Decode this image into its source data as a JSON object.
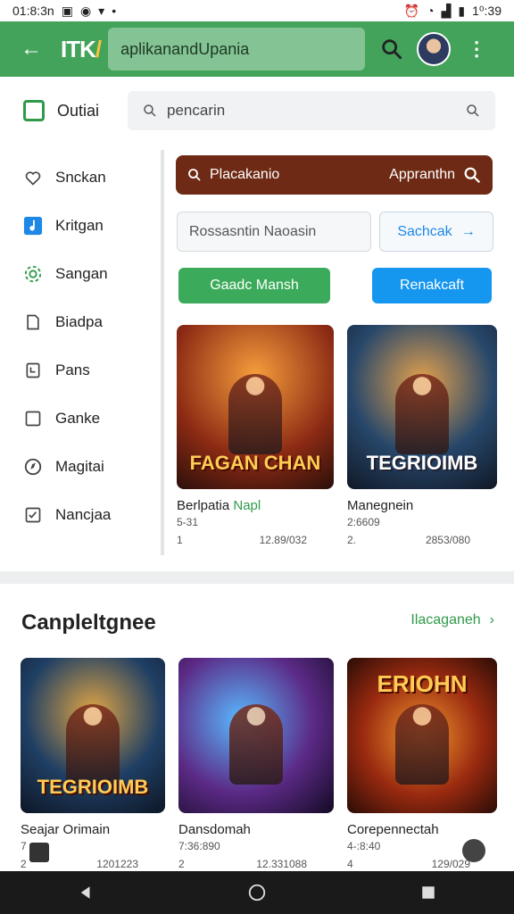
{
  "status": {
    "time_left": "01:8:3n",
    "time_right": "1⁰:39"
  },
  "appbar": {
    "logo": "ITK",
    "logo_accent": "/",
    "url": "aplikanandUpania"
  },
  "header": {
    "label": "Outiai",
    "search_placeholder": "pencarin"
  },
  "sidebar": {
    "items": [
      {
        "label": "Snckan",
        "icon": "heart-shield-icon"
      },
      {
        "label": "Kritgan",
        "icon": "music-note-icon"
      },
      {
        "label": "Sangan",
        "icon": "gear-icon"
      },
      {
        "label": "Biadpa",
        "icon": "document-icon"
      },
      {
        "label": "Pans",
        "icon": "bookmark-icon"
      },
      {
        "label": "Ganke",
        "icon": "square-icon"
      },
      {
        "label": "Magitai",
        "icon": "compass-icon"
      },
      {
        "label": "Nancjaa",
        "icon": "check-box-icon"
      }
    ]
  },
  "main": {
    "big_search": {
      "left": "Placakanio",
      "right": "Appranthn"
    },
    "field_placeholder": "Rossasntin Naoasin",
    "search_button": "Sachcak",
    "green_button": "Gaadc Mansh",
    "blue_button": "Renakcaft",
    "cards": [
      {
        "title": "Berlpatia",
        "title_accent": "Napl",
        "sub": "5-31",
        "meta_left": "1",
        "meta_right": "12.89/032",
        "art_text": "FAGAN CHAN"
      },
      {
        "title": "Manegnein",
        "title_accent": "",
        "sub": "2:6609",
        "meta_left": "2.",
        "meta_right": "2853/080",
        "art_text": "TEGRIOIMB"
      }
    ]
  },
  "section": {
    "title": "Canpleltgnee",
    "more": "Ilacaganeh",
    "cards": [
      {
        "title": "Seajar Orimain",
        "sub": "7",
        "meta_left": "2",
        "meta_right": "1201223",
        "art_text": "TEGRIOIMB"
      },
      {
        "title": "Dansdomah",
        "sub": "7:36:890",
        "meta_left": "2",
        "meta_right": "12.331088",
        "art_text": ""
      },
      {
        "title": "Corepennectah",
        "sub": "4-:8:40",
        "meta_left": "4",
        "meta_right": "129/029",
        "art_text": "ERIOHN"
      }
    ]
  }
}
